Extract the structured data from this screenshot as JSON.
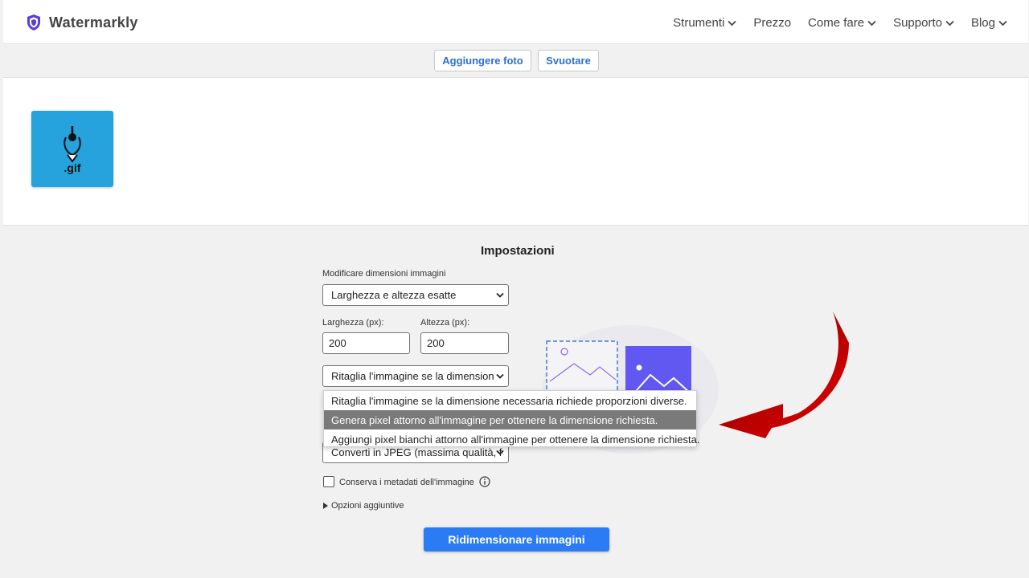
{
  "header": {
    "brand": "Watermarkly",
    "nav": [
      "Strumenti",
      "Prezzo",
      "Come fare",
      "Supporto",
      "Blog"
    ]
  },
  "toolbar": {
    "add_label": "Aggiungere foto",
    "clear_label": "Svuotare"
  },
  "images": {
    "thumb_label": ".gif"
  },
  "settings": {
    "title": "Impostazioni",
    "resize_label": "Modificare dimensioni immagini",
    "resize_value": "Larghezza e altezza esatte",
    "width_label": "Larghezza (px):",
    "width_value": "200",
    "height_label": "Altezza (px):",
    "height_value": "200",
    "fit_value": "Ritaglia l'immagine se la dimension",
    "fit_options": [
      "Ritaglia l'immagine se la dimensione necessaria richiede proporzioni diverse.",
      "Genera pixel attorno all'immagine per ottenere la dimensione richiesta.",
      "Aggiungi pixel bianchi attorno all'immagine per ottenere la dimensione richiesta."
    ],
    "format_value": "Converti in JPEG (massima qualità, f",
    "metadata_label": "Conserva i metadati dell'immagine",
    "metadata_checked": false,
    "more_label": "Opzioni aggiuntive",
    "submit_label": "Ridimensionare immagini"
  },
  "colors": {
    "accent": "#2b7cf4",
    "link": "#2a6fd6",
    "arrow": "#d40000",
    "thumb_bg": "#26a2dc",
    "brand_shield": "#5b3fd6"
  },
  "icons": [
    "shield-logo-icon",
    "chevron-down-icon",
    "select-arrow-icon",
    "info-icon",
    "disclosure-triangle-icon",
    "red-arrow-annotation"
  ]
}
